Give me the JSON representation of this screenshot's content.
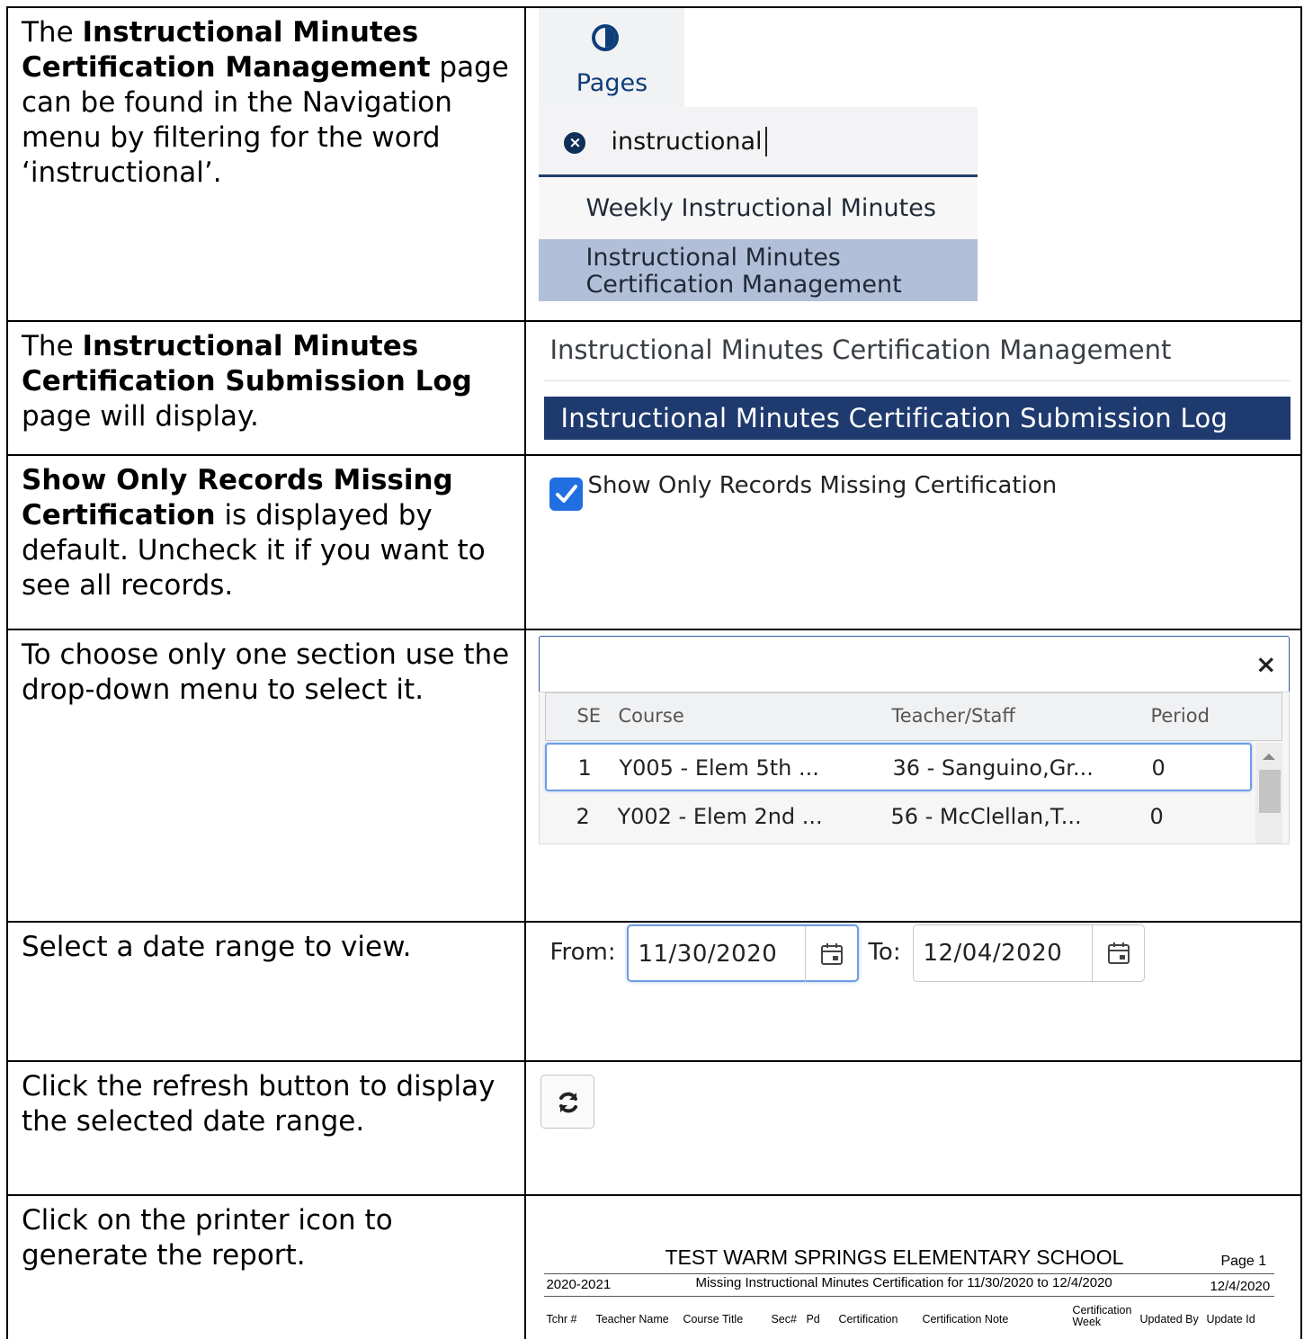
{
  "rows": [
    {
      "text_parts": [
        "The ",
        "Instructional Minutes Certification Management",
        " page can be found in the Navigation menu by filtering for the word ‘instructional’."
      ]
    },
    {
      "text_parts": [
        "The ",
        "Instructional Minutes Certification Submission Log",
        " page will display."
      ]
    },
    {
      "text_parts": [
        "Show Only Records Missing Certification",
        " is displayed by default. Uncheck it if you want to see all records."
      ]
    },
    {
      "text": "To choose only one section use the drop-down menu to select it."
    },
    {
      "text": "Select a date range to view."
    },
    {
      "text": "Click the refresh button to display the selected date range."
    },
    {
      "text": "Click on the printer icon to generate the report."
    }
  ],
  "nav": {
    "tab_label": "Pages",
    "filter_value": "instructional",
    "results": [
      "Weekly Instructional Minutes",
      "Instructional Minutes",
      "Certification Management"
    ]
  },
  "page_header": {
    "title": "Instructional Minutes Certification Management",
    "section_bar": "Instructional Minutes Certification Submission Log"
  },
  "filter_checkbox": {
    "label": "Show Only Records Missing Certification",
    "checked": true
  },
  "section_dropdown": {
    "close": "×",
    "columns": [
      "SE",
      "Course",
      "Teacher/Staff",
      "Period"
    ],
    "rows": [
      [
        "1",
        "Y005 - Elem 5th ...",
        "36 - Sanguino,Gr...",
        "0"
      ],
      [
        "2",
        "Y002 - Elem 2nd ...",
        "56 - McClellan,T...",
        "0"
      ]
    ]
  },
  "date_range": {
    "from_label": "From:",
    "from_value": "11/30/2020",
    "to_label": "To:",
    "to_value": "12/04/2020"
  },
  "report": {
    "school": "TEST WARM SPRINGS ELEMENTARY SCHOOL",
    "page": "Page 1",
    "year": "2020-2021",
    "subtitle": "Missing Instructional Minutes Certification for 11/30/2020 to 12/4/2020",
    "date": "12/4/2020",
    "columns": [
      "Tchr #",
      "Teacher Name",
      "Course Title",
      "Sec#",
      "Pd",
      "Certification",
      "Certification Note",
      "Certification",
      "Week",
      "Updated By",
      "Update Id"
    ]
  },
  "colors": {
    "nav_blue": "#0e3d7a",
    "section_bar": "#1f3a6e",
    "selected_row": "#b2bfd9",
    "checkbox": "#1f6fe0"
  }
}
